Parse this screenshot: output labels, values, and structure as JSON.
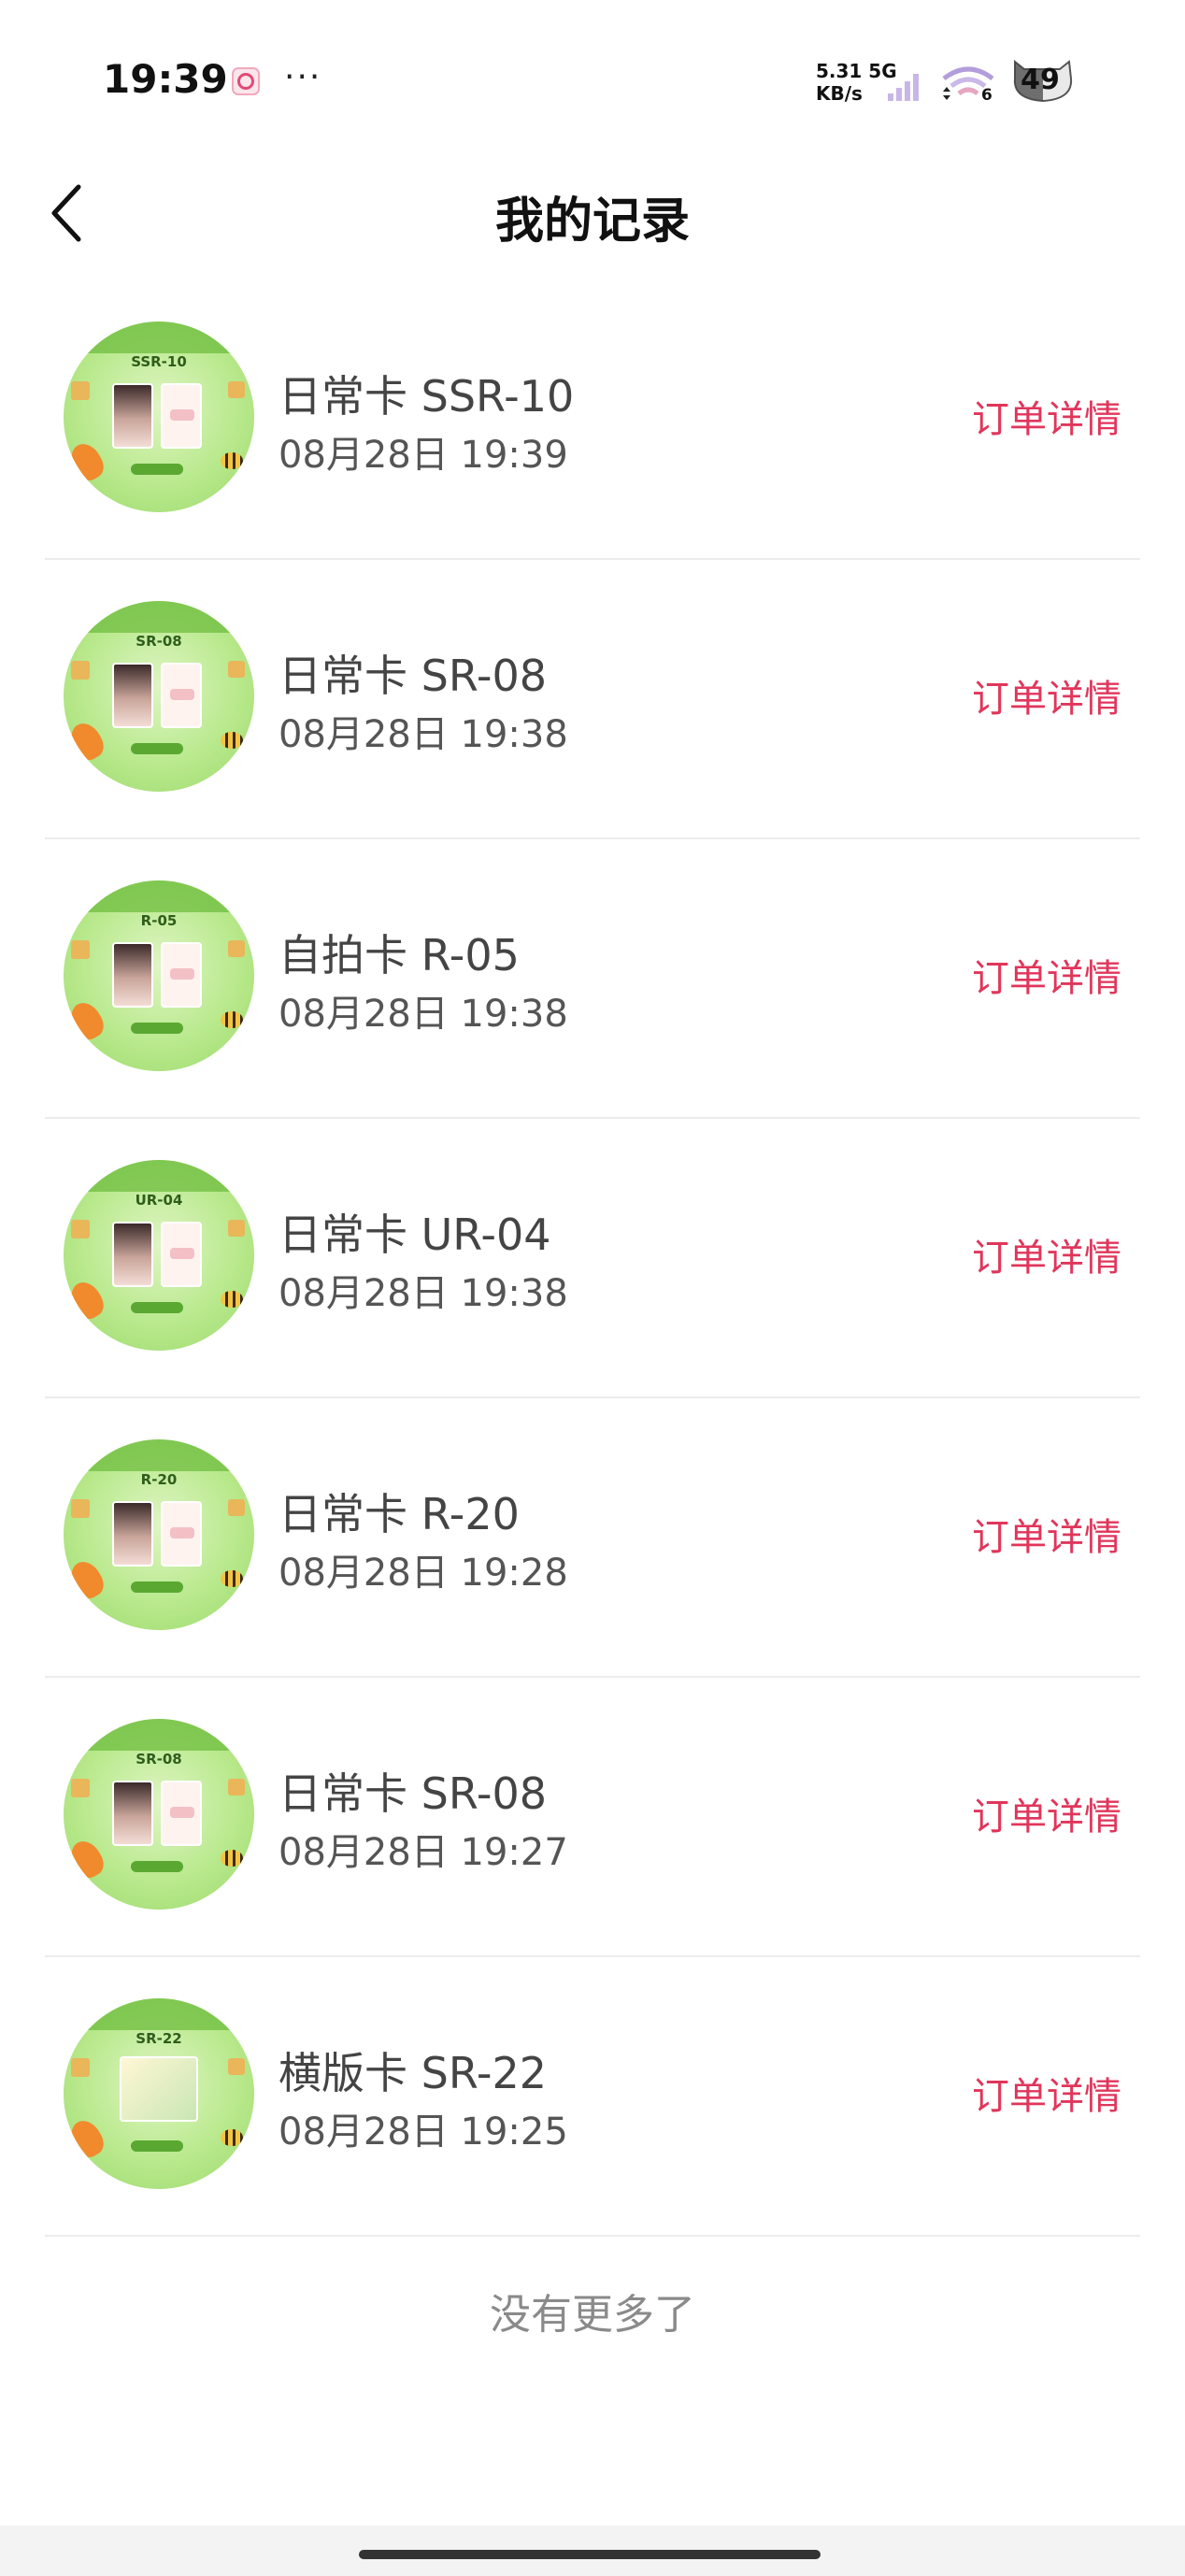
{
  "status_bar": {
    "time": "19:39",
    "dots": "···",
    "net_speed_value": "5.31 5G",
    "net_speed_unit": "KB/s",
    "wifi_number": "6",
    "battery": "49"
  },
  "header": {
    "title": "我的记录",
    "back_icon": "chevron-left-icon"
  },
  "records": [
    {
      "code": "SSR-10",
      "title": "日常卡 SSR-10",
      "time": "08月28日 19:39",
      "action": "订单详情"
    },
    {
      "code": "SR-08",
      "title": "日常卡 SR-08",
      "time": "08月28日 19:38",
      "action": "订单详情"
    },
    {
      "code": "R-05",
      "title": "自拍卡 R-05",
      "time": "08月28日 19:38",
      "action": "订单详情"
    },
    {
      "code": "UR-04",
      "title": "日常卡 UR-04",
      "time": "08月28日 19:38",
      "action": "订单详情"
    },
    {
      "code": "R-20",
      "title": "日常卡 R-20",
      "time": "08月28日 19:28",
      "action": "订单详情"
    },
    {
      "code": "SR-08",
      "title": "日常卡 SR-08",
      "time": "08月28日 19:27",
      "action": "订单详情"
    },
    {
      "code": "SR-22",
      "title": "横版卡 SR-22",
      "time": "08月28日 19:25",
      "action": "订单详情"
    }
  ],
  "footer": {
    "no_more": "没有更多了"
  },
  "colors": {
    "accent": "#e0365b",
    "thumb_green": "#b9e98d"
  }
}
